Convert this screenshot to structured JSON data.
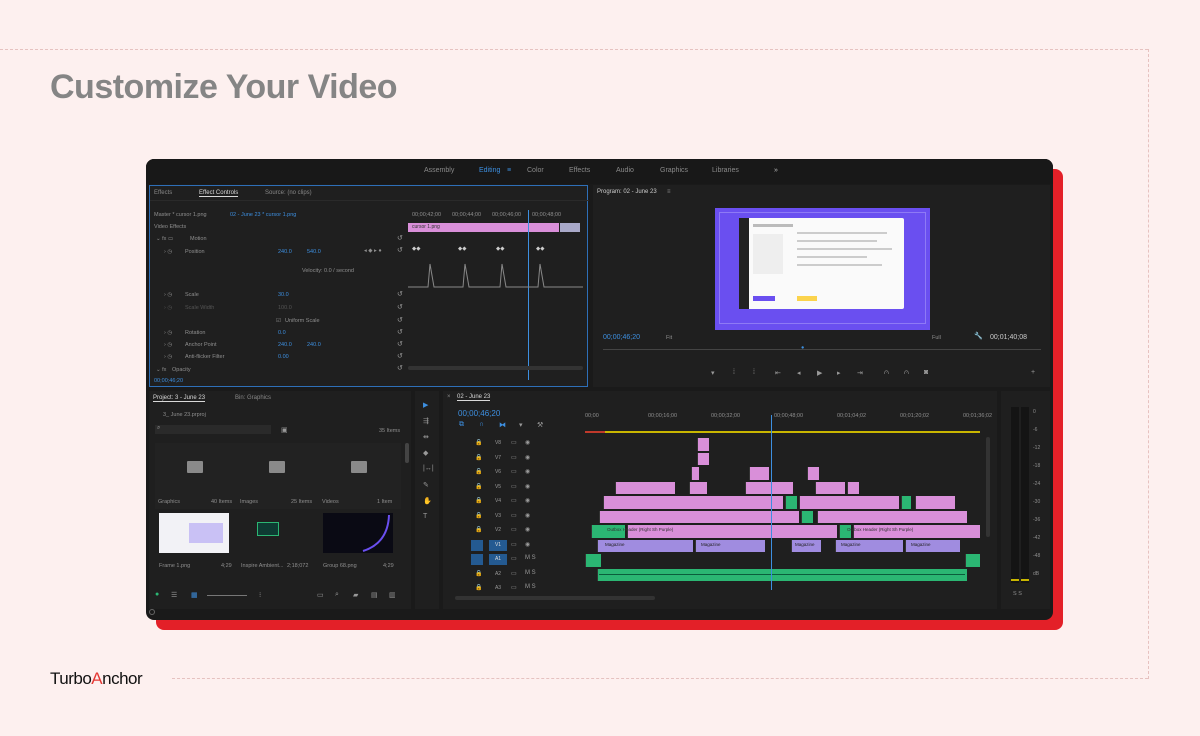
{
  "page": {
    "title": "Customize Your Video",
    "brand_a": "Turbo",
    "brand_b": "A",
    "brand_c": "nchor"
  },
  "colors": {
    "background": "#fdf0ef",
    "accent_red": "#e32028",
    "premiere_blue": "#3d8fe0",
    "clip_pink": "#d98fd9",
    "clip_green": "#2bb673",
    "clip_purple": "#a08ce0"
  },
  "workspaces": [
    {
      "label": "Assembly"
    },
    {
      "label": "Editing",
      "active": true
    },
    {
      "label": "Color"
    },
    {
      "label": "Effects"
    },
    {
      "label": "Audio"
    },
    {
      "label": "Graphics"
    },
    {
      "label": "Libraries"
    }
  ],
  "effect_panel": {
    "tabs": [
      "Effects",
      "Effect Controls",
      "Source: (no clips)"
    ],
    "master": "Master * cursor 1.png",
    "sequence": "02 - June 23 * cursor 1.png",
    "section": "Video Effects",
    "motion": "Motion",
    "position": {
      "label": "Position",
      "x": "240.0",
      "y": "540.0"
    },
    "velocity": "Velocity: 0.0 / second",
    "scale": {
      "label": "Scale",
      "value": "30.0"
    },
    "scale_width": {
      "label": "Scale Width",
      "value": "100.0"
    },
    "uniform": "Uniform Scale",
    "rotation": {
      "label": "Rotation",
      "value": "0.0"
    },
    "anchor": {
      "label": "Anchor Point",
      "x": "240.0",
      "y": "240.0"
    },
    "flicker": {
      "label": "Anti-flicker Filter",
      "value": "0.00"
    },
    "opacity": "Opacity",
    "timecode": "00;00;46;20",
    "ruler": [
      "00;00;42;00",
      "00;00;44;00",
      "00;00;46;00",
      "00;00;48;00"
    ],
    "clip": "cursor 1.png"
  },
  "program": {
    "title": "Program: 02 - June 23",
    "timecode_left": "00;00;46;20",
    "fit": "Fit",
    "full": "Full",
    "timecode_right": "00;01;40;08"
  },
  "project": {
    "tabs": [
      "Project: 3 - June 23",
      "Bin: Graphics"
    ],
    "path": "3_ June 23.prproj",
    "items_count": "35 Items",
    "bins": [
      {
        "name": "Graphics",
        "count": "40 Items"
      },
      {
        "name": "Images",
        "count": "25 Items"
      },
      {
        "name": "Videos",
        "count": "1 Item"
      }
    ],
    "thumbs": [
      {
        "name": "Frame 1.png",
        "dur": "4;29"
      },
      {
        "name": "Inspire Ambient...",
        "dur": "2;18;072"
      },
      {
        "name": "Group 68.png",
        "dur": "4;29"
      }
    ]
  },
  "timeline": {
    "title": "02 - June 23",
    "timecode": "00;00;46;20",
    "ruler": [
      "00;00",
      "00;00;16;00",
      "00;00;32;00",
      "00;00;48;00",
      "00;01;04;02",
      "00;01;20;02",
      "00;01;36;02"
    ],
    "tracks": [
      "V8",
      "V7",
      "V6",
      "V5",
      "V4",
      "V3",
      "V2",
      "V1",
      "A1",
      "A2",
      "A3"
    ],
    "clip_label_1": "Outbox Header (Right Sh Purple)",
    "clip_label_2": "Outbox Header (Right Sh Purple)",
    "v1_clips": [
      "Magazine",
      "Magazine",
      "Magazine",
      "Magazine",
      "Magazine"
    ]
  },
  "meter": {
    "labels": [
      "0",
      "-6",
      "-12",
      "-18",
      "-24",
      "-30",
      "-36",
      "-42",
      "-48",
      "dB"
    ]
  }
}
